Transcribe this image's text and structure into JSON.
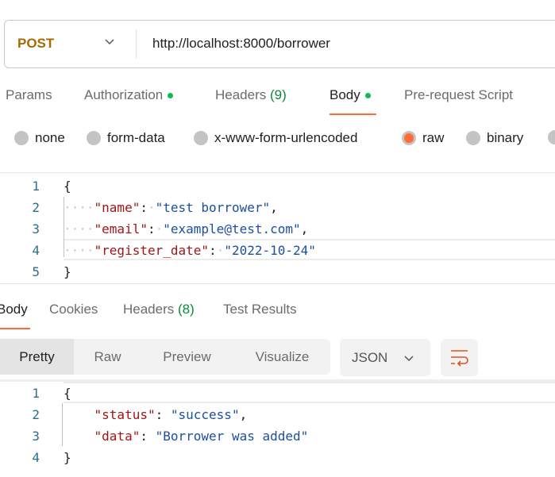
{
  "request": {
    "method": "POST",
    "url": "http://localhost:8000/borrower",
    "tabs": [
      {
        "label": "Params"
      },
      {
        "label": "Authorization",
        "dot": true
      },
      {
        "label": "Headers",
        "count": "(9)"
      },
      {
        "label": "Body",
        "dot": true,
        "active": true
      },
      {
        "label": "Pre-request Script"
      }
    ],
    "body_types": [
      "none",
      "form-data",
      "x-www-form-urlencoded",
      "raw",
      "binary"
    ],
    "selected_body_type": "raw",
    "code": [
      {
        "n": "1",
        "open": "{"
      },
      {
        "n": "2",
        "key": "\"name\"",
        "value": "\"test borrower\"",
        "comma": ","
      },
      {
        "n": "3",
        "key": "\"email\"",
        "value": "\"example@test.com\"",
        "comma": ","
      },
      {
        "n": "4",
        "key": "\"register_date\"",
        "value": "\"2022-10-24\"",
        "comma": ""
      },
      {
        "n": "5",
        "close": "}"
      }
    ]
  },
  "response": {
    "tabs": [
      {
        "label": "Body",
        "active": true
      },
      {
        "label": "Cookies"
      },
      {
        "label": "Headers",
        "count": "(8)"
      },
      {
        "label": "Test Results"
      }
    ],
    "views": [
      "Pretty",
      "Raw",
      "Preview",
      "Visualize"
    ],
    "active_view": "Pretty",
    "format": "JSON",
    "code": [
      {
        "n": "1",
        "open": "{"
      },
      {
        "n": "2",
        "key": "\"status\"",
        "value": "\"success\"",
        "comma": ","
      },
      {
        "n": "3",
        "key": "\"data\"",
        "value": "\"Borrower was added\"",
        "comma": ""
      },
      {
        "n": "4",
        "close": "}"
      }
    ]
  },
  "colors": {
    "accent": "#ff6c37",
    "method": "#a66b00",
    "dot": "#0cbb52",
    "key": "#a31515",
    "string": "#1c4fa0"
  }
}
